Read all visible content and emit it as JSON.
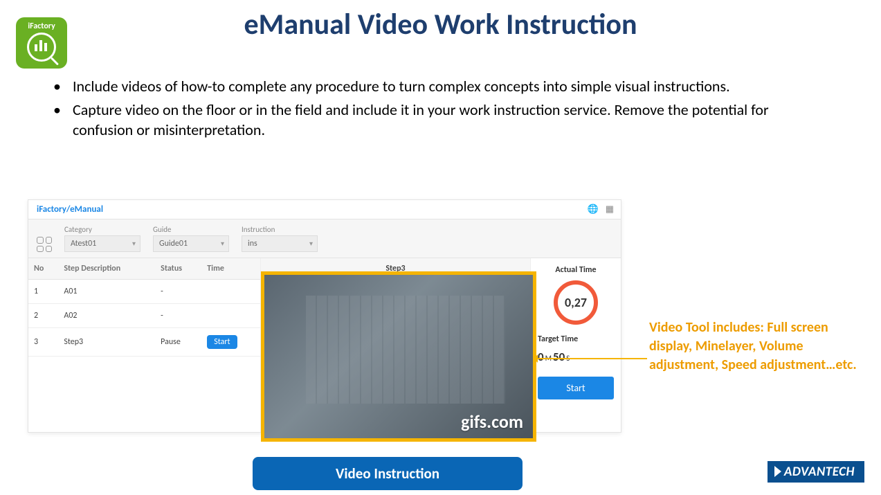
{
  "badge": {
    "label": "iFactory"
  },
  "title": "eManual Video Work Instruction",
  "bullets": [
    "Include videos of how-to complete any procedure to turn complex concepts into simple visual instructions.",
    "Capture video on the floor or in the field and include it in your work instruction service. Remove the potential for confusion or misinterpretation."
  ],
  "app": {
    "breadcrumb1": "iFactory/",
    "breadcrumb2": "eManual",
    "filters": {
      "category_label": "Category",
      "category_value": "Atest01",
      "guide_label": "Guide",
      "guide_value": "Guide01",
      "instruction_label": "Instruction",
      "instruction_value": "ins"
    },
    "table": {
      "head_no": "No",
      "head_step": "Step Description",
      "head_status": "Status",
      "head_time": "Time",
      "rows": [
        {
          "no": "1",
          "desc": "A01",
          "status": "-",
          "time": ""
        },
        {
          "no": "2",
          "desc": "A02",
          "status": "-",
          "time": ""
        },
        {
          "no": "3",
          "desc": "Step3",
          "status": "Pause",
          "time": "Start"
        }
      ]
    },
    "center_title": "Step3",
    "right": {
      "actual_label": "Actual Time",
      "actual_value": "0,27",
      "target_label": "Target Time",
      "target_min": "0",
      "target_m": "M",
      "target_sec": "50",
      "target_s": "S",
      "start_label": "Start"
    }
  },
  "video_watermark": "gifs.com",
  "callout": "Video Tool includes: Full screen display, Minelayer, Volume adjustment, Speed adjustment…etc.",
  "vi_button": "Video Instruction",
  "logo": "ADVANTECH"
}
